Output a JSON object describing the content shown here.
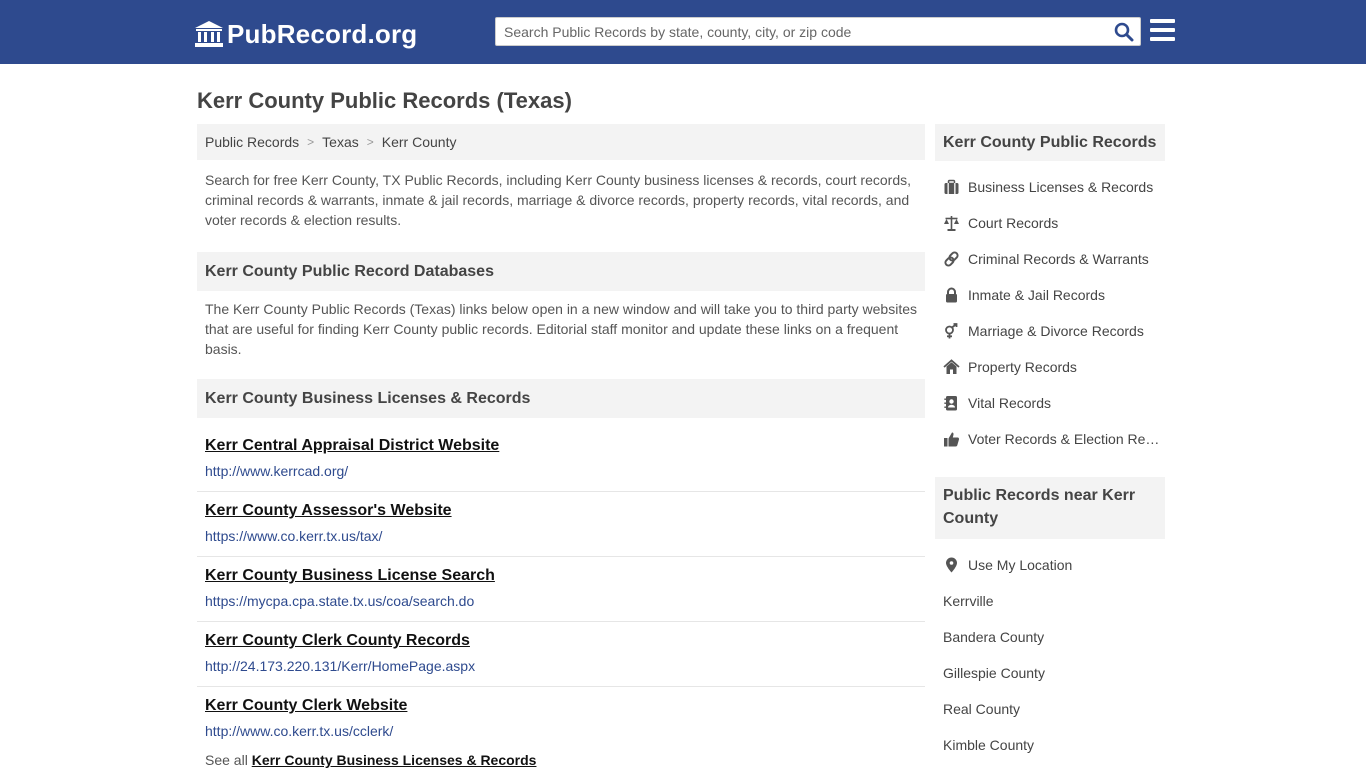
{
  "header": {
    "logo_text": "PubRecord.org",
    "search_placeholder": "Search Public Records by state, county, city, or zip code"
  },
  "page": {
    "title": "Kerr County Public Records (Texas)",
    "breadcrumb": [
      "Public Records",
      "Texas",
      "Kerr County"
    ],
    "intro": "Search for free Kerr County, TX Public Records, including Kerr County business licenses & records, court records, criminal records & warrants, inmate & jail records, marriage & divorce records, property records, vital records, and voter records & election results."
  },
  "databases": {
    "heading": "Kerr County Public Record Databases",
    "description": "The Kerr County Public Records (Texas) links below open in a new window and will take you to third party websites that are useful for finding Kerr County public records. Editorial staff monitor and update these links on a frequent basis."
  },
  "business": {
    "heading": "Kerr County Business Licenses & Records",
    "links": [
      {
        "title": "Kerr Central Appraisal District Website",
        "url": "http://www.kerrcad.org/"
      },
      {
        "title": "Kerr County Assessor's Website",
        "url": "https://www.co.kerr.tx.us/tax/"
      },
      {
        "title": "Kerr County Business License Search",
        "url": "https://mycpa.cpa.state.tx.us/coa/search.do"
      },
      {
        "title": "Kerr County Clerk County Records",
        "url": "http://24.173.220.131/Kerr/HomePage.aspx"
      },
      {
        "title": "Kerr County Clerk Website",
        "url": "http://www.co.kerr.tx.us/cclerk/"
      }
    ],
    "see_all_prefix": "See all",
    "see_all_link": "Kerr County Business Licenses & Records"
  },
  "sidebar": {
    "records_heading": "Kerr County Public Records",
    "records": [
      {
        "label": "Business Licenses & Records",
        "icon": "briefcase-icon"
      },
      {
        "label": "Court Records",
        "icon": "scale-icon"
      },
      {
        "label": "Criminal Records & Warrants",
        "icon": "link-icon"
      },
      {
        "label": "Inmate & Jail Records",
        "icon": "lock-icon"
      },
      {
        "label": "Marriage & Divorce Records",
        "icon": "gender-icon"
      },
      {
        "label": "Property Records",
        "icon": "home-icon"
      },
      {
        "label": "Vital Records",
        "icon": "address-book-icon"
      },
      {
        "label": "Voter Records & Election Results",
        "icon": "thumbs-up-icon"
      }
    ],
    "nearby_heading": "Public Records near Kerr County",
    "use_location": "Use My Location",
    "nearby": [
      "Kerrville",
      "Bandera County",
      "Gillespie County",
      "Real County",
      "Kimble County"
    ]
  },
  "colors": {
    "header_bg": "#2e4a8e",
    "link_url": "#2e4a8e",
    "panel_bg": "#f3f3f3"
  }
}
